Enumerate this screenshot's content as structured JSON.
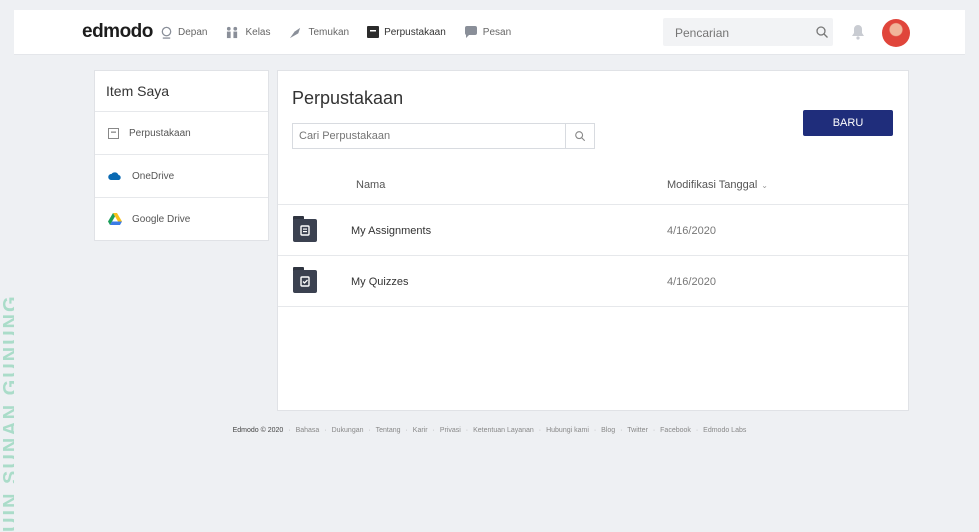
{
  "watermark": "UIN SUNAN GUNUNG DJATI",
  "nav": {
    "logo": "edmodo",
    "items": [
      {
        "label": "Depan",
        "icon": "home-icon"
      },
      {
        "label": "Kelas",
        "icon": "class-icon"
      },
      {
        "label": "Temukan",
        "icon": "discover-icon"
      },
      {
        "label": "Perpustakaan",
        "icon": "library-icon"
      },
      {
        "label": "Pesan",
        "icon": "message-icon"
      }
    ],
    "search_placeholder": "Pencarian"
  },
  "sidebar": {
    "title": "Item Saya",
    "items": [
      {
        "label": "Perpustakaan",
        "icon": "library-icon"
      },
      {
        "label": "OneDrive",
        "icon": "onedrive-icon"
      },
      {
        "label": "Google Drive",
        "icon": "google-drive-icon"
      }
    ]
  },
  "main": {
    "title": "Perpustakaan",
    "search_placeholder": "Cari Perpustakaan",
    "new_button": "BARU",
    "columns": {
      "name": "Nama",
      "date": "Modifikasi Tanggal"
    },
    "rows": [
      {
        "name": "My Assignments",
        "date": "4/16/2020",
        "icon": "assignment-folder-icon"
      },
      {
        "name": "My Quizzes",
        "date": "4/16/2020",
        "icon": "quiz-folder-icon"
      }
    ]
  },
  "footer": {
    "brand": "Edmodo © 2020",
    "links": [
      "Bahasa",
      "Dukungan",
      "Tentang",
      "Karir",
      "Privasi",
      "Ketentuan Layanan",
      "Hubungi kami",
      "Blog",
      "Twitter",
      "Facebook",
      "Edmodo Labs"
    ]
  },
  "colors": {
    "accent": "#1f2d7b",
    "background": "#eef0f3"
  }
}
